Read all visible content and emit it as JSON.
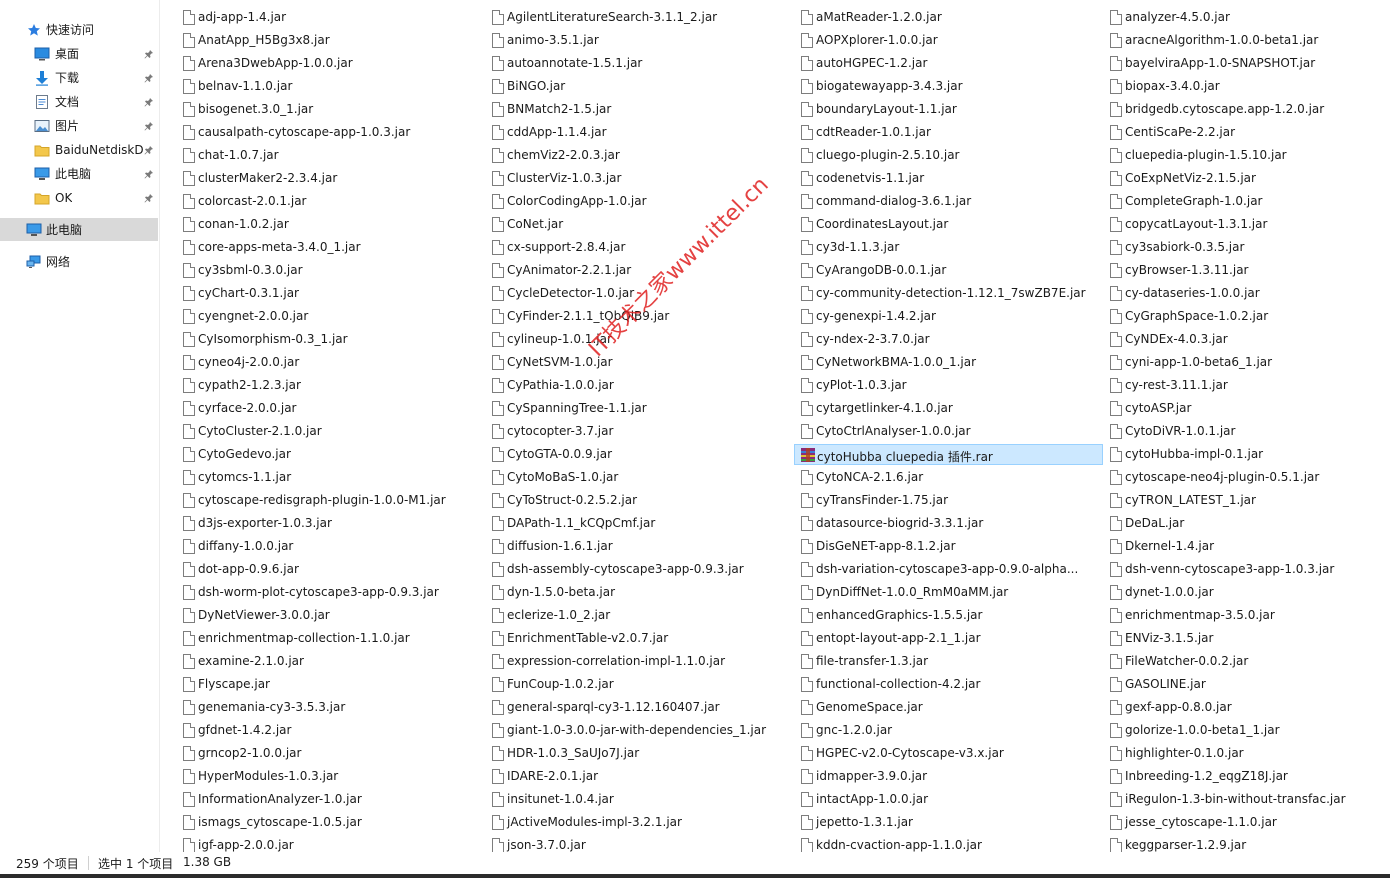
{
  "nav": {
    "quick_access": "快速访问",
    "items": [
      {
        "label": "桌面",
        "icon": "desktop-icon",
        "pinned": true
      },
      {
        "label": "下载",
        "icon": "download-icon",
        "pinned": true
      },
      {
        "label": "文档",
        "icon": "document-icon",
        "pinned": true
      },
      {
        "label": "图片",
        "icon": "picture-icon",
        "pinned": true
      },
      {
        "label": "BaiduNetdiskD",
        "icon": "folder-icon",
        "pinned": true
      },
      {
        "label": "此电脑",
        "icon": "computer-icon",
        "pinned": true
      },
      {
        "label": "OK",
        "icon": "folder-icon",
        "pinned": true
      }
    ],
    "this_pc": "此电脑",
    "network": "网络"
  },
  "files": {
    "columns": [
      [
        "adj-app-1.4.jar",
        "AnatApp_H5Bg3x8.jar",
        "Arena3DwebApp-1.0.0.jar",
        "belnav-1.1.0.jar",
        "bisogenet.3.0_1.jar",
        "causalpath-cytoscape-app-1.0.3.jar",
        "chat-1.0.7.jar",
        "clusterMaker2-2.3.4.jar",
        "colorcast-2.0.1.jar",
        "conan-1.0.2.jar",
        "core-apps-meta-3.4.0_1.jar",
        "cy3sbml-0.3.0.jar",
        "cyChart-0.3.1.jar",
        "cyengnet-2.0.0.jar",
        "CyIsomorphism-0.3_1.jar",
        "cyneo4j-2.0.0.jar",
        "cypath2-1.2.3.jar",
        "cyrface-2.0.0.jar",
        "CytoCluster-2.1.0.jar",
        "CytoGedevo.jar",
        "cytomcs-1.1.jar",
        "cytoscape-redisgraph-plugin-1.0.0-M1.jar",
        "d3js-exporter-1.0.3.jar",
        "diffany-1.0.0.jar",
        "dot-app-0.9.6.jar",
        "dsh-worm-plot-cytoscape3-app-0.9.3.jar",
        "DyNetViewer-3.0.0.jar",
        "enrichmentmap-collection-1.1.0.jar",
        "examine-2.1.0.jar",
        "Flyscape.jar",
        "genemania-cy3-3.5.3.jar",
        "gfdnet-1.4.2.jar",
        "grncop2-1.0.0.jar",
        "HyperModules-1.0.3.jar",
        "InformationAnalyzer-1.0.jar",
        "ismags_cytoscape-1.0.5.jar",
        "igf-app-2.0.0.jar"
      ],
      [
        "AgilentLiteratureSearch-3.1.1_2.jar",
        "animo-3.5.1.jar",
        "autoannotate-1.5.1.jar",
        "BiNGO.jar",
        "BNMatch2-1.5.jar",
        "cddApp-1.1.4.jar",
        "chemViz2-2.0.3.jar",
        "ClusterViz-1.0.3.jar",
        "ColorCodingApp-1.0.jar",
        "CoNet.jar",
        "cx-support-2.8.4.jar",
        "CyAnimator-2.2.1.jar",
        "CycleDetector-1.0.jar",
        "CyFinder-2.1.1_tObQlB9.jar",
        "cylineup-1.0.1.jar",
        "CyNetSVM-1.0.jar",
        "CyPathia-1.0.0.jar",
        "CySpanningTree-1.1.jar",
        "cytocopter-3.7.jar",
        "CytoGTA-0.0.9.jar",
        "CytoMoBaS-1.0.jar",
        "CyToStruct-0.2.5.2.jar",
        "DAPath-1.1_kCQpCmf.jar",
        "diffusion-1.6.1.jar",
        "dsh-assembly-cytoscape3-app-0.9.3.jar",
        "dyn-1.5.0-beta.jar",
        "eclerize-1.0_2.jar",
        "EnrichmentTable-v2.0.7.jar",
        "expression-correlation-impl-1.1.0.jar",
        "FunCoup-1.0.2.jar",
        "general-sparql-cy3-1.12.160407.jar",
        "giant-1.0-3.0.0-jar-with-dependencies_1.jar",
        "HDR-1.0.3_SaUJo7J.jar",
        "IDARE-2.0.1.jar",
        "insitunet-1.0.4.jar",
        "jActiveModules-impl-3.2.1.jar",
        "json-3.7.0.jar"
      ],
      [
        "aMatReader-1.2.0.jar",
        "AOPXplorer-1.0.0.jar",
        "autoHGPEC-1.2.jar",
        "biogatewayapp-3.4.3.jar",
        "boundaryLayout-1.1.jar",
        "cdtReader-1.0.1.jar",
        "cluego-plugin-2.5.10.jar",
        "codenetvis-1.1.jar",
        "command-dialog-3.6.1.jar",
        "CoordinatesLayout.jar",
        "cy3d-1.1.3.jar",
        "CyArangoDB-0.0.1.jar",
        "cy-community-detection-1.12.1_7swZB7E.jar",
        "cy-genexpi-1.4.2.jar",
        "cy-ndex-2-3.7.0.jar",
        "CyNetworkBMA-1.0.0_1.jar",
        "cyPlot-1.0.3.jar",
        "cytargetlinker-4.1.0.jar",
        "CytoCtrlAnalyser-1.0.0.jar",
        "cytoHubba cluepedia 插件.rar",
        "CytoNCA-2.1.6.jar",
        "cyTransFinder-1.75.jar",
        "datasource-biogrid-3.3.1.jar",
        "DisGeNET-app-8.1.2.jar",
        "dsh-variation-cytoscape3-app-0.9.0-alpha...",
        "DynDiffNet-1.0.0_RmM0aMM.jar",
        "enhancedGraphics-1.5.5.jar",
        "entopt-layout-app-2.1_1.jar",
        "file-transfer-1.3.jar",
        "functional-collection-4.2.jar",
        "GenomeSpace.jar",
        "gnc-1.2.0.jar",
        "HGPEC-v2.0-Cytoscape-v3.x.jar",
        "idmapper-3.9.0.jar",
        "intactApp-1.0.0.jar",
        "jepetto-1.3.1.jar",
        "kddn-cvaction-app-1.1.0.jar"
      ],
      [
        "analyzer-4.5.0.jar",
        "aracneAlgorithm-1.0.0-beta1.jar",
        "bayelviraApp-1.0-SNAPSHOT.jar",
        "biopax-3.4.0.jar",
        "bridgedb.cytoscape.app-1.2.0.jar",
        "CentiScaPe-2.2.jar",
        "cluepedia-plugin-1.5.10.jar",
        "CoExpNetViz-2.1.5.jar",
        "CompleteGraph-1.0.jar",
        "copycatLayout-1.3.1.jar",
        "cy3sabiork-0.3.5.jar",
        "cyBrowser-1.3.11.jar",
        "cy-dataseries-1.0.0.jar",
        "CyGraphSpace-1.0.2.jar",
        "CyNDEx-4.0.3.jar",
        "cyni-app-1.0-beta6_1.jar",
        "cy-rest-3.11.1.jar",
        "cytoASP.jar",
        "CytoDiVR-1.0.1.jar",
        "cytoHubba-impl-0.1.jar",
        "cytoscape-neo4j-plugin-0.5.1.jar",
        "cyTRON_LATEST_1.jar",
        "DeDaL.jar",
        "Dkernel-1.4.jar",
        "dsh-venn-cytoscape3-app-1.0.3.jar",
        "dynet-1.0.0.jar",
        "enrichmentmap-3.5.0.jar",
        "ENViz-3.1.5.jar",
        "FileWatcher-0.0.2.jar",
        "GASOLINE.jar",
        "gexf-app-0.8.0.jar",
        "golorize-1.0.0-beta1_1.jar",
        "highlighter-0.1.0.jar",
        "Inbreeding-1.2_eqgZ18J.jar",
        "iRegulon-1.3-bin-without-transfac.jar",
        "jesse_cytoscape-1.1.0.jar",
        "keggparser-1.2.9.jar"
      ]
    ],
    "selected": "cytoHubba cluepedia 插件.rar"
  },
  "status": {
    "item_count": "259 个项目",
    "selected_count": "选中 1 个项目",
    "selected_size": "1.38 GB"
  },
  "watermark": "IT技术之家www.ittel.cn",
  "colors": {
    "selection_bg": "#cce8ff",
    "nav_selected_bg": "#d9d9d9",
    "icon_blue": "#1e7fd6",
    "folder_yellow": "#f3c74b",
    "watermark_red": "#e02020"
  }
}
